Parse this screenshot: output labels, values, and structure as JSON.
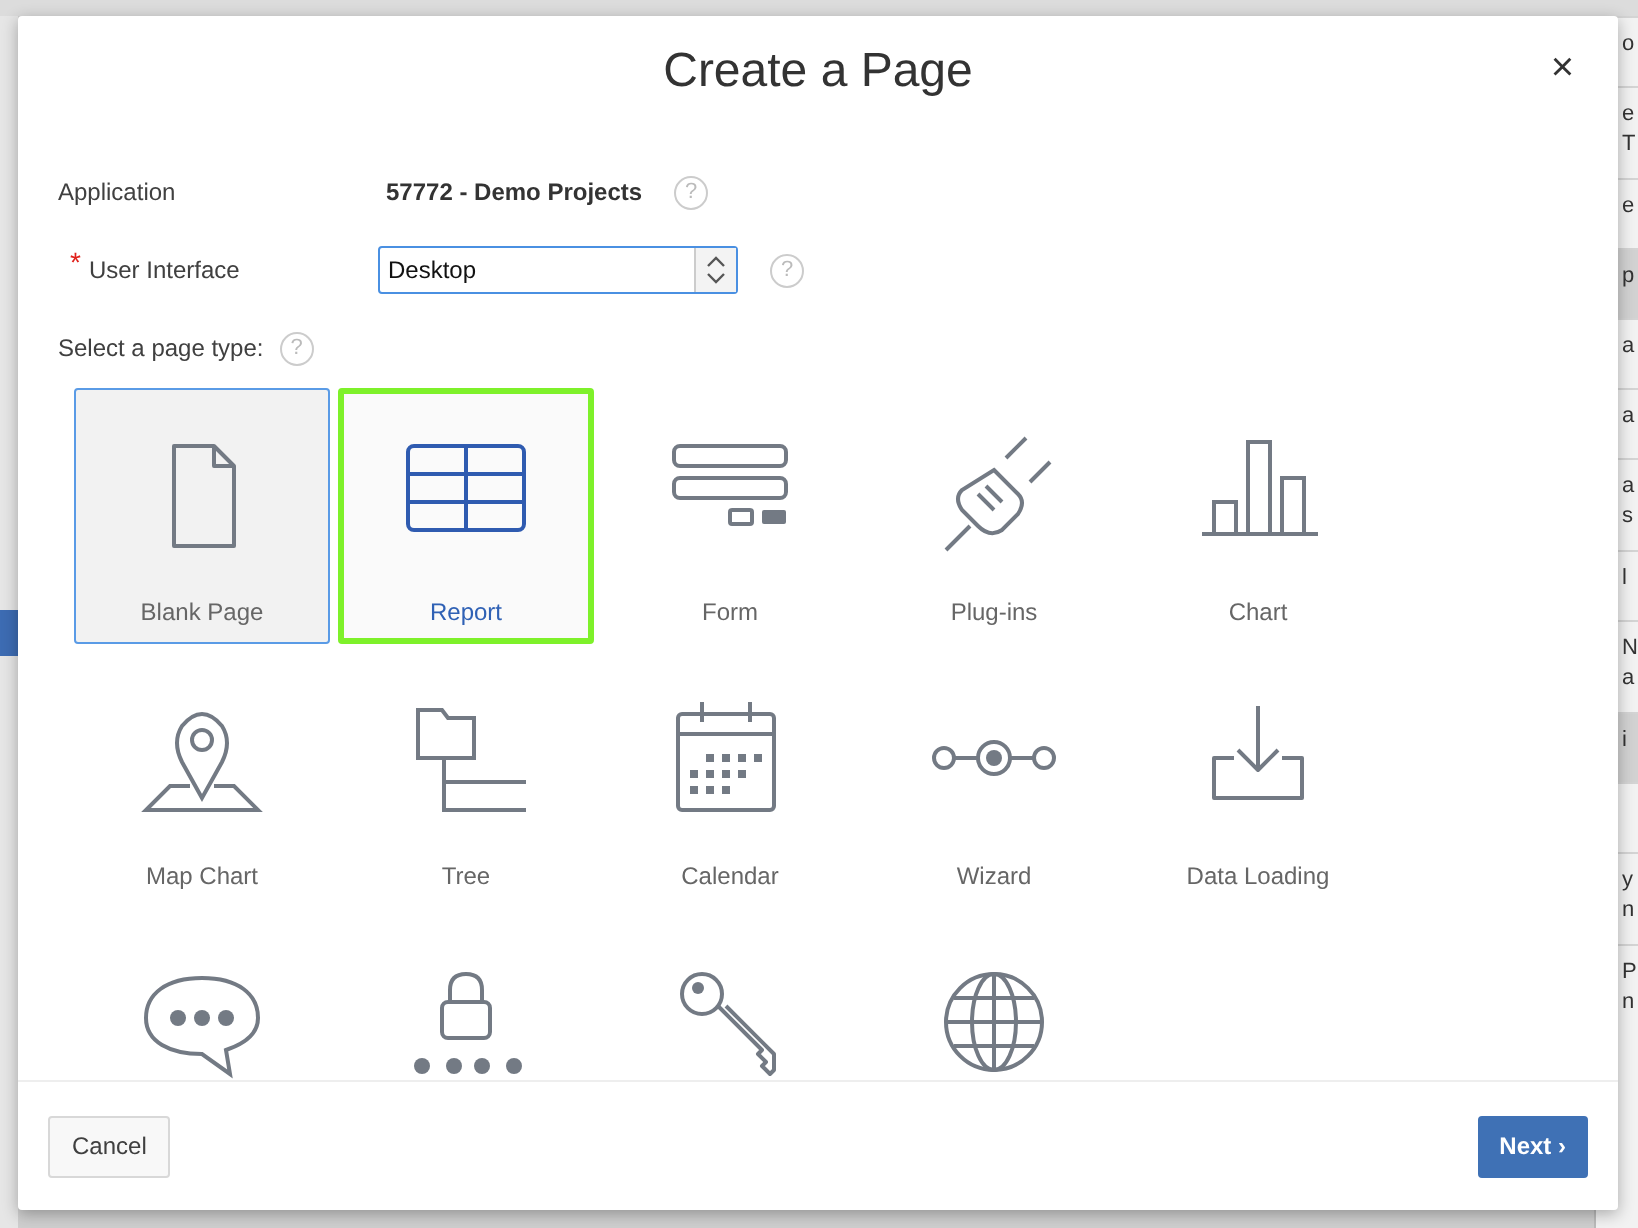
{
  "dialog": {
    "title": "Create a Page",
    "close": "×"
  },
  "fields": [
    {
      "kind": "static",
      "label": "Application",
      "value": "57772 - Demo Projects",
      "help": "?"
    },
    {
      "kind": "select",
      "label": "User Interface",
      "required_mark": "*",
      "value": "Desktop",
      "help": "?"
    }
  ],
  "page_type_prompt": {
    "label": "Select a page type:",
    "help": "?"
  },
  "page_types": [
    {
      "kind": "page",
      "label": "Blank Page",
      "selected": false,
      "focused": true
    },
    {
      "kind": "table",
      "label": "Report",
      "selected": true,
      "focused": false
    },
    {
      "kind": "form",
      "label": "Form",
      "selected": false,
      "focused": false
    },
    {
      "kind": "plug",
      "label": "Plug-ins",
      "selected": false,
      "focused": false
    },
    {
      "kind": "bar-chart",
      "label": "Chart",
      "selected": false,
      "focused": false
    },
    {
      "kind": "map-pin",
      "label": "Map Chart",
      "selected": false,
      "focused": false
    },
    {
      "kind": "tree",
      "label": "Tree",
      "selected": false,
      "focused": false
    },
    {
      "kind": "calendar",
      "label": "Calendar",
      "selected": false,
      "focused": false
    },
    {
      "kind": "wizard",
      "label": "Wizard",
      "selected": false,
      "focused": false
    },
    {
      "kind": "download",
      "label": "Data Loading",
      "selected": false,
      "focused": false
    },
    {
      "kind": "chat",
      "selected": false,
      "focused": false
    },
    {
      "kind": "lock",
      "selected": false,
      "focused": false
    },
    {
      "kind": "key",
      "selected": false,
      "focused": false
    },
    {
      "kind": "globe",
      "selected": false,
      "focused": false
    }
  ],
  "buttons": [
    {
      "kind": "secondary",
      "label": "Cancel"
    },
    {
      "kind": "primary",
      "label": "Next",
      "arrow": "›"
    }
  ],
  "background_rows": [
    {
      "lines": [
        "o"
      ],
      "shaded": false
    },
    {
      "lines": [
        "e",
        "T"
      ],
      "shaded": false
    },
    {
      "lines": [
        "e"
      ],
      "shaded": false
    },
    {
      "lines": [
        "p"
      ],
      "shaded": true
    },
    {
      "lines": [
        "a"
      ],
      "shaded": false
    },
    {
      "lines": [
        "a"
      ],
      "shaded": false
    },
    {
      "lines": [
        "a",
        "s"
      ],
      "shaded": false
    },
    {
      "lines": [
        "l"
      ],
      "shaded": false
    },
    {
      "lines": [
        "N",
        "a"
      ],
      "shaded": false
    },
    {
      "lines": [
        "i"
      ],
      "shaded": true
    },
    {
      "shaded": false
    },
    {
      "lines": [
        "y",
        "n"
      ],
      "shaded": false
    },
    {
      "lines": [
        "P",
        "n"
      ],
      "shaded": false
    }
  ]
}
